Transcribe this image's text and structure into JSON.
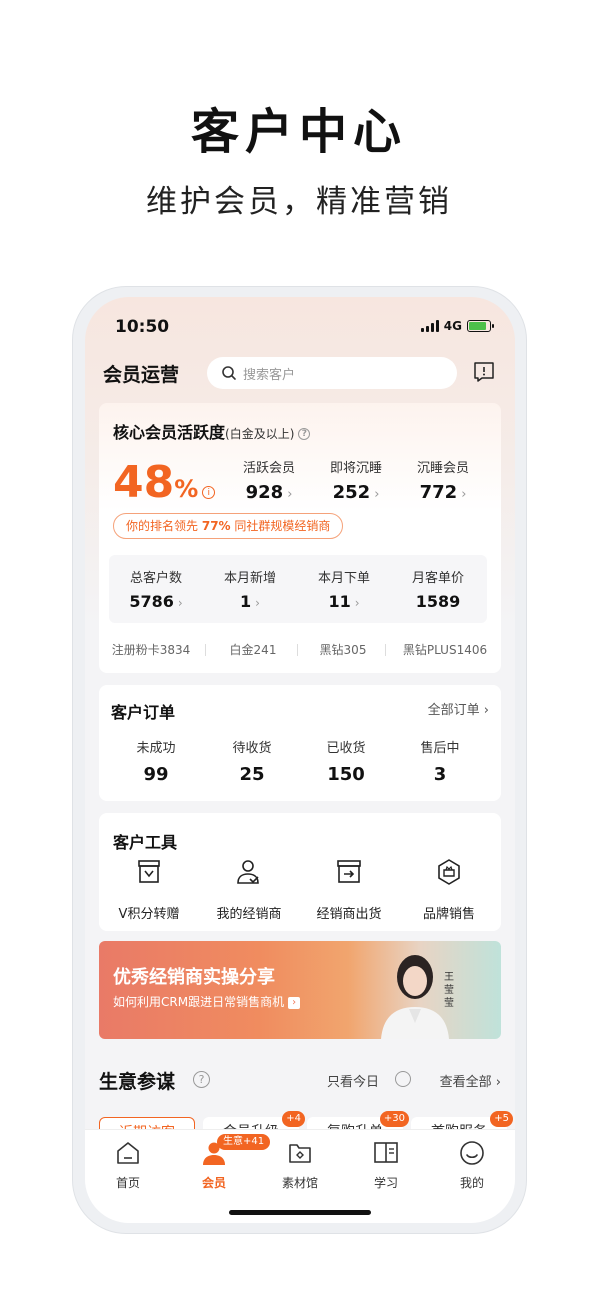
{
  "hero": {
    "title": "客户中心",
    "subtitle": "维护会员，精准营销"
  },
  "status_bar": {
    "time": "10:50",
    "network": "4G",
    "battery_level": 0.85
  },
  "header": {
    "title": "会员运营",
    "search_placeholder": "搜索客户",
    "icons": [
      "search-icon",
      "message-icon"
    ]
  },
  "activity": {
    "title": "核心会员活跃度",
    "title_note": "(白金及以上)",
    "rate": "48",
    "rate_unit": "%",
    "metrics": [
      {
        "label": "活跃会员",
        "value": "928"
      },
      {
        "label": "即将沉睡",
        "value": "252"
      },
      {
        "label": "沉睡会员",
        "value": "772"
      }
    ],
    "rank_prefix": "你的排名领先",
    "rank_value": "77%",
    "rank_suffix": "同社群规模经销商"
  },
  "stats": [
    {
      "label": "总客户数",
      "value": "5786",
      "chevron": true
    },
    {
      "label": "本月新增",
      "value": "1",
      "chevron": true
    },
    {
      "label": "本月下单",
      "value": "11",
      "chevron": true
    },
    {
      "label": "月客单价",
      "value": "1589",
      "chevron": false
    }
  ],
  "tiers": [
    "注册粉卡3834",
    "白金241",
    "黑钻305",
    "黑钻PLUS1406"
  ],
  "orders": {
    "title": "客户订单",
    "all_label": "全部订单 ›",
    "items": [
      {
        "label": "未成功",
        "value": "99"
      },
      {
        "label": "待收货",
        "value": "25"
      },
      {
        "label": "已收货",
        "value": "150"
      },
      {
        "label": "售后中",
        "value": "3"
      }
    ]
  },
  "tools": {
    "title": "客户工具",
    "items": [
      {
        "label": "V积分转赠",
        "icon": "points-transfer-icon"
      },
      {
        "label": "我的经销商",
        "icon": "dealer-icon"
      },
      {
        "label": "经销商出货",
        "icon": "shipment-icon"
      },
      {
        "label": "品牌销售",
        "icon": "brand-sales-icon"
      }
    ]
  },
  "banner": {
    "title": "优秀经销商实操分享",
    "subtitle": "如何利用CRM跟进日常销售商机",
    "speaker": "王莹莹"
  },
  "advisor": {
    "title": "生意参谋",
    "today_only": "只看今日",
    "view_all": "查看全部 ›",
    "chips": [
      {
        "label": "近期访客",
        "badge": ""
      },
      {
        "label": "会员升级",
        "badge": "+4"
      },
      {
        "label": "复购升单",
        "badge": "+30"
      },
      {
        "label": "首购服务",
        "badge": "+5"
      }
    ]
  },
  "tabbar": {
    "items": [
      {
        "label": "首页",
        "icon": "home-icon"
      },
      {
        "label": "会员",
        "icon": "member-icon",
        "badge": "生意+41"
      },
      {
        "label": "素材馆",
        "icon": "material-icon"
      },
      {
        "label": "学习",
        "icon": "learn-icon"
      },
      {
        "label": "我的",
        "icon": "profile-icon"
      }
    ],
    "active_index": 1
  },
  "colors": {
    "accent": "#f26522",
    "text": "#222222",
    "muted": "#999999",
    "banner_start": "#e97a67",
    "banner_end": "#bfe2da"
  }
}
